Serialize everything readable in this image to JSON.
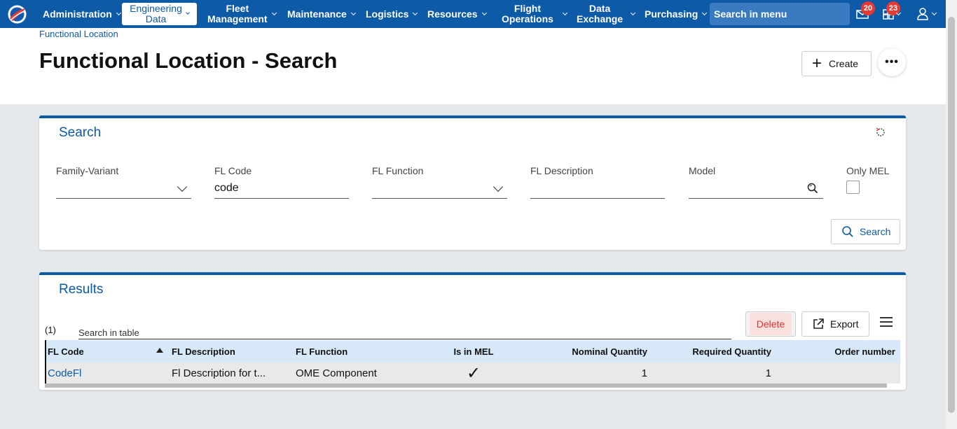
{
  "nav": {
    "items": [
      {
        "label": "Administration"
      },
      {
        "label": "Engineering Data",
        "line1": "Engineering",
        "line2": "Data",
        "active": true
      },
      {
        "label": "Fleet Management",
        "line1": "Fleet",
        "line2": "Management"
      },
      {
        "label": "Maintenance"
      },
      {
        "label": "Logistics"
      },
      {
        "label": "Resources"
      },
      {
        "label": "Flight Operations",
        "line1": "Flight",
        "line2": "Operations"
      },
      {
        "label": "Data Exchange",
        "line1": "Data",
        "line2": "Exchange"
      },
      {
        "label": "Purchasing"
      }
    ],
    "search_placeholder": "Search in menu",
    "mail_badge": "20",
    "tasks_badge": "23",
    "icons": [
      "mail-icon",
      "tasks-icon",
      "user-icon"
    ],
    "accent_color": "#0d5aa7"
  },
  "breadcrumb": "Functional Location",
  "page": {
    "title": "Functional Location - Search",
    "create_label": "Create",
    "more_label": "•••"
  },
  "search": {
    "title": "Search",
    "fields": {
      "family_variant": {
        "label": "Family-Variant",
        "value": ""
      },
      "fl_code": {
        "label": "FL Code",
        "value": "code"
      },
      "fl_function": {
        "label": "FL Function",
        "value": ""
      },
      "fl_description": {
        "label": "FL Description",
        "value": ""
      },
      "model": {
        "label": "Model",
        "value": ""
      },
      "only_mel": {
        "label": "Only MEL",
        "checked": false
      }
    },
    "search_button": "Search"
  },
  "results": {
    "title": "Results",
    "count": "(1)",
    "table_search_placeholder": "Search in table",
    "delete_label": "Delete",
    "export_label": "Export",
    "columns": [
      "FL Code",
      "FL Description",
      "FL Function",
      "Is in MEL",
      "Nominal Quantity",
      "Required Quantity",
      "Order number"
    ],
    "sort": {
      "column": "FL Code",
      "direction": "ascending"
    },
    "rows": [
      {
        "fl_code": "CodeFl",
        "fl_description": "Fl Description for t...",
        "fl_function": "OME Component",
        "is_in_mel": "✓",
        "nominal_quantity": "1",
        "required_quantity": "1",
        "order_number": ""
      }
    ]
  }
}
